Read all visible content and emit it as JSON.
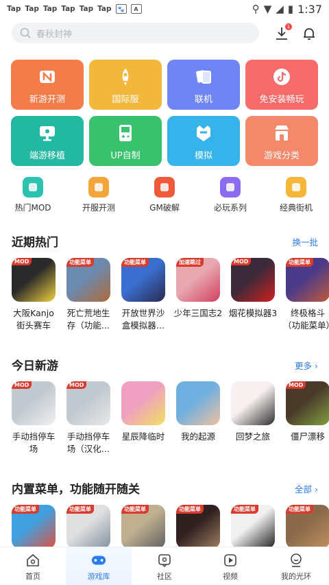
{
  "status_bar": {
    "apps": [
      "Tap",
      "Tap",
      "Tap",
      "Tap",
      "Tap",
      "Tap"
    ],
    "time": "1:37"
  },
  "search": {
    "placeholder": "春秋封神"
  },
  "download_badge": "1",
  "tiles": [
    {
      "label": "新游开测",
      "color": "#f47c4a",
      "icon": "n-badge-icon"
    },
    {
      "label": "国际服",
      "color": "#f3b73c",
      "icon": "rocket-icon"
    },
    {
      "label": "联机",
      "color": "#6f85f6",
      "icon": "cards-icon"
    },
    {
      "label": "免安装畅玩",
      "color": "#f76b6b",
      "icon": "tiktok-icon"
    },
    {
      "label": "端游移植",
      "color": "#23b8a2",
      "icon": "monitor-icon"
    },
    {
      "label": "UP自制",
      "color": "#39c26e",
      "icon": "gameboy-icon"
    },
    {
      "label": "模拟",
      "color": "#35b3ea",
      "icon": "helmet-icon"
    },
    {
      "label": "游戏分类",
      "color": "#f4886a",
      "icon": "shop-icon"
    }
  ],
  "shortcuts": [
    {
      "label": "热门MOD",
      "icon": "gamepad-icon",
      "color": "#2bc3b0"
    },
    {
      "label": "开服开测",
      "icon": "n-icon",
      "color": "#f5a43a"
    },
    {
      "label": "GM破解",
      "icon": "bt-icon",
      "color": "#f05a3a"
    },
    {
      "label": "必玩系列",
      "icon": "planet-icon",
      "color": "#8b6cf0"
    },
    {
      "label": "经典街机",
      "icon": "arcade-icon",
      "color": "#f5b63a"
    }
  ],
  "sections": [
    {
      "title": "近期热门",
      "more": "换一批",
      "games": [
        {
          "name": "大阪Kanjo街头赛车",
          "tag": "MOD",
          "c1": "#2a2a2a",
          "c2": "#f0d040"
        },
        {
          "name": "死亡荒地生存（功能…",
          "tag": "功能菜单",
          "c1": "#6a8ab0",
          "c2": "#b06a3a"
        },
        {
          "name": "开放世界沙盒模拟器…",
          "tag": "功能菜单",
          "c1": "#3a6fd0",
          "c2": "#2a2a50"
        },
        {
          "name": "少年三国志2",
          "tag": "加速跳过",
          "c1": "#e8a8b0",
          "c2": "#d04060"
        },
        {
          "name": "烟花模拟器3",
          "tag": "MOD",
          "c1": "#3a2a3a",
          "c2": "#d02020"
        },
        {
          "name": "终极格斗（功能菜单）",
          "tag": "功能菜单",
          "c1": "#4a3a8a",
          "c2": "#c05a3a"
        }
      ]
    },
    {
      "title": "今日新游",
      "more": "更多 ›",
      "games": [
        {
          "name": "手动挡停车场",
          "tag": "MOD",
          "c1": "#c0c8d0",
          "c2": "#f0f0f0"
        },
        {
          "name": "手动挡停车场（汉化…",
          "tag": "MOD",
          "c1": "#c0c8d0",
          "c2": "#e8e8e8"
        },
        {
          "name": "星辰降临时",
          "tag": "",
          "c1": "#f0a0c0",
          "c2": "#f0e060"
        },
        {
          "name": "我的起源",
          "tag": "",
          "c1": "#70b0e0",
          "c2": "#f0c0a0"
        },
        {
          "name": "回梦之旅",
          "tag": "",
          "c1": "#f8f0f0",
          "c2": "#303030"
        },
        {
          "name": "僵尸漂移",
          "tag": "MOD",
          "c1": "#4a3a2a",
          "c2": "#80a040"
        }
      ]
    },
    {
      "title": "内置菜单，功能随开随关",
      "more": "全部 ›",
      "games": [
        {
          "name": "",
          "tag": "功能菜单",
          "c1": "#40a0e0",
          "c2": "#e05040"
        },
        {
          "name": "",
          "tag": "功能菜单",
          "c1": "#e0e0e0",
          "c2": "#8090a0"
        },
        {
          "name": "",
          "tag": "功能菜单",
          "c1": "#c0b090",
          "c2": "#606060"
        },
        {
          "name": "",
          "tag": "功能菜单",
          "c1": "#302020",
          "c2": "#a08060"
        },
        {
          "name": "",
          "tag": "功能菜单",
          "c1": "#f0f0f0",
          "c2": "#202020"
        },
        {
          "name": "",
          "tag": "功能菜单",
          "c1": "#8a6a4a",
          "c2": "#c09060"
        }
      ]
    }
  ],
  "nav": [
    {
      "label": "首页",
      "icon": "home-icon",
      "active": false
    },
    {
      "label": "游戏库",
      "icon": "gamepad-icon",
      "active": true
    },
    {
      "label": "社区",
      "icon": "community-icon",
      "active": false
    },
    {
      "label": "视频",
      "icon": "video-icon",
      "active": false
    },
    {
      "label": "我的光环",
      "icon": "profile-icon",
      "active": false
    }
  ]
}
